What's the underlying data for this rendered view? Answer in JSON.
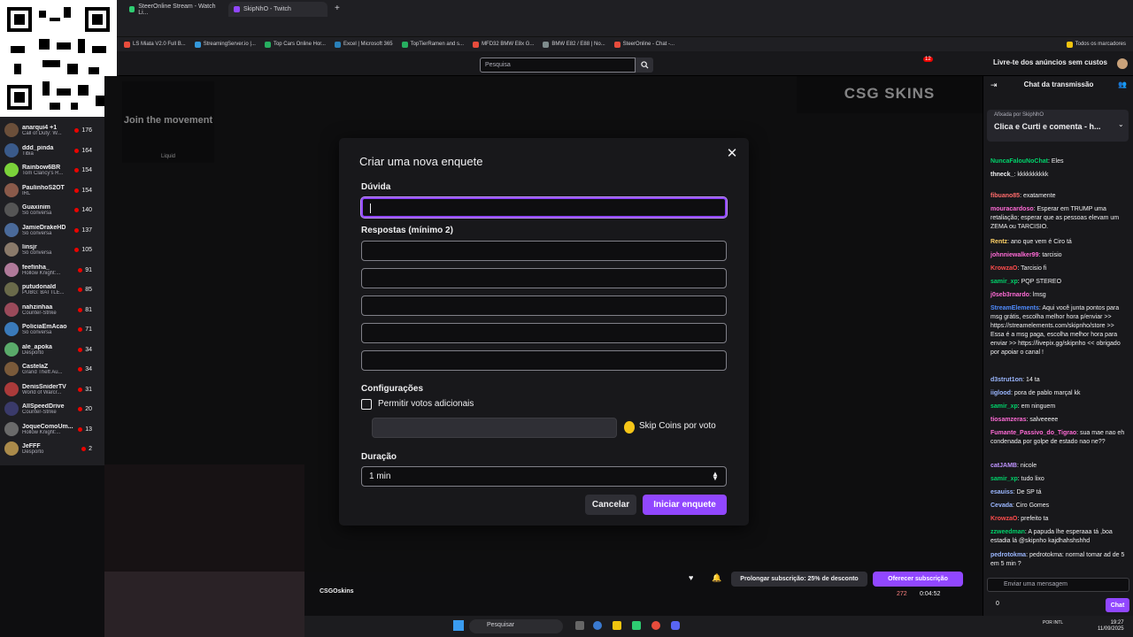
{
  "browser": {
    "tabs": [
      "SteerOnline Stream - Watch Li...",
      "SkipNhO - Twitch"
    ],
    "bookmarks": [
      "LS Miata V2.0 Full B...",
      "StreamingServer.io |...",
      "Top Cars Online Hor...",
      "Excel | Microsoft 365",
      "TopTierRamen and s...",
      "MFD32 BMW E8x G...",
      "BMW E82 / E88 | No...",
      "SteerOnline - Chat -..."
    ],
    "bookmarks_all": "Todos os marcadores"
  },
  "topnav": {
    "search_placeholder": "Pesquisa",
    "notifications_count": "12",
    "no_ads": "Livre-te dos anúncios sem custos"
  },
  "sidebar": {
    "channels": [
      {
        "name": "anarqui4 +1",
        "game": "Call of Duty: W...",
        "viewers": "176"
      },
      {
        "name": "ddd_pinda",
        "game": "Tibia",
        "viewers": "164"
      },
      {
        "name": "Rainbow6BR",
        "game": "Tom Clancy's R...",
        "viewers": "154"
      },
      {
        "name": "PaulinhoS2OT",
        "game": "IRL",
        "viewers": "154"
      },
      {
        "name": "Guaxinim",
        "game": "Só conversa",
        "viewers": "140"
      },
      {
        "name": "JamieDrakeHD",
        "game": "Só conversa",
        "viewers": "137"
      },
      {
        "name": "linsjr",
        "game": "Só conversa",
        "viewers": "105"
      },
      {
        "name": "feefinha_",
        "game": "Hollow Knight:...",
        "viewers": "91"
      },
      {
        "name": "putudonald",
        "game": "PUBG: BATTLE...",
        "viewers": "85"
      },
      {
        "name": "nahzinhaa",
        "game": "Counter-Strike",
        "viewers": "81"
      },
      {
        "name": "PoliciaEmAcao",
        "game": "Só conversa",
        "viewers": "71"
      },
      {
        "name": "ale_apoka",
        "game": "Desporto",
        "viewers": "34"
      },
      {
        "name": "CastelaZ",
        "game": "Grand Theft Au...",
        "viewers": "34"
      },
      {
        "name": "DenisSniderTV",
        "game": "World of Warcr...",
        "viewers": "31"
      },
      {
        "name": "AllSpeedDrive",
        "game": "Counter-Strike",
        "viewers": "20"
      },
      {
        "name": "JoqueComoUm...",
        "game": "Hollow Knight:...",
        "viewers": "13"
      },
      {
        "name": "JeFFF",
        "game": "Desporto",
        "viewers": "2"
      }
    ]
  },
  "ads": {
    "left_text": "Join the movement",
    "left_brand": "Liquid",
    "right_text": "CSG SKINS"
  },
  "modal": {
    "title": "Criar uma nova enquete",
    "question_label": "Dúvida",
    "answers_label": "Respostas (mínimo 2)",
    "config_label": "Configurações",
    "additional_votes": "Permitir votos adicionais",
    "coins_label": "Skip Coins por voto",
    "duration_label": "Duração",
    "duration_value": "1 min",
    "cancel": "Cancelar",
    "start": "Iniciar enquete"
  },
  "chat": {
    "header": "Chat da transmissão",
    "pinned_by": "Afixada por SkipNhO",
    "pinned_text": "Clica e Curti e comenta - h...",
    "messages": [
      {
        "user": "NuncaFalouNoChat",
        "color": "#00d26a",
        "text": ": Eles"
      },
      {
        "user": "thneck_",
        "color": "#efeff1",
        "text": ": kkkkkkkkkk"
      },
      {
        "user": "fibuano85",
        "color": "#ff6b6b",
        "text": ": exatamente"
      },
      {
        "user": "mouracardoso",
        "color": "#ff6bd6",
        "text": ": Esperar em TRUMP uma retaliação; esperar que as pessoas elevam um ZEMA ou TARCISIO."
      },
      {
        "user": "Rentz",
        "color": "#ffd166",
        "text": ": ano que vem é Ciro tá"
      },
      {
        "user": "johnniewalker99",
        "color": "#ff6bd6",
        "text": ": tarcisio"
      },
      {
        "user": "KrowzaO",
        "color": "#ff4d4d",
        "text": ": Tarcisio fi"
      },
      {
        "user": "samir_xp",
        "color": "#00d26a",
        "text": ": PQP STEREO"
      },
      {
        "user": "j0seb3rnardo",
        "color": "#ff6bd6",
        "text": ": lmsg"
      },
      {
        "user": "StreamElements",
        "color": "#4f8cff",
        "text": ": Aqui você junta pontos para msg grátis, escolha melhor hora p/enviar >> https://streamelements.com/skipnho/store >> Essa é a msg paga, escolha melhor hora para enviar >> https://livepix.gg/skipnho << obrigado por apoiar o canal !"
      },
      {
        "user": "d3strut1on",
        "color": "#9bb7ff",
        "text": ": 14 ta"
      },
      {
        "user": "iiglood",
        "color": "#9bb7ff",
        "text": ": pora de pablo marçal kk"
      },
      {
        "user": "samir_xp",
        "color": "#00d26a",
        "text": ": em ninguem"
      },
      {
        "user": "tiosamzeras",
        "color": "#ff6bd6",
        "text": ": salveeeee"
      },
      {
        "user": "Fumante_Passivo_do_Tigrao",
        "color": "#ff6bd6",
        "text": ": sua mae nao eh condenada por golpe de estado nao ne??"
      },
      {
        "user": "catJAMB",
        "color": "#bf94ff",
        "text": ": nicole"
      },
      {
        "user": "samir_xp",
        "color": "#00d26a",
        "text": ": tudo lixo"
      },
      {
        "user": "esauiss",
        "color": "#9bb7ff",
        "text": ": De SP tá"
      },
      {
        "user": "Cevada",
        "color": "#9bb7ff",
        "text": ": Ciro Gomes"
      },
      {
        "user": "KrowzaO",
        "color": "#ff4d4d",
        "text": ": prefeito ta"
      },
      {
        "user": "zzweedman",
        "color": "#00d26a",
        "text": ": A papuda lhe esperaaa tá ,boa estadia lá @skipnho kajdhahshshhd"
      },
      {
        "user": "pedrotokma",
        "color": "#9bb7ff",
        "text": ": pedrotokma: normal tomar ad de 5 em 5 min ?"
      }
    ],
    "input_placeholder": "Enviar uma mensagem",
    "send_button": "Chat",
    "points": "0"
  },
  "under_video": {
    "tagline": "CSGOskins",
    "prolong": "Prolongar subscrição: 25% de desconto",
    "gift": "Oferecer subscrição",
    "viewers": "272",
    "uptime": "0:04:52"
  },
  "taskbar": {
    "search": "Pesquisar",
    "time": "19:27",
    "date": "11/09/2025",
    "lang": "POR INTL"
  }
}
